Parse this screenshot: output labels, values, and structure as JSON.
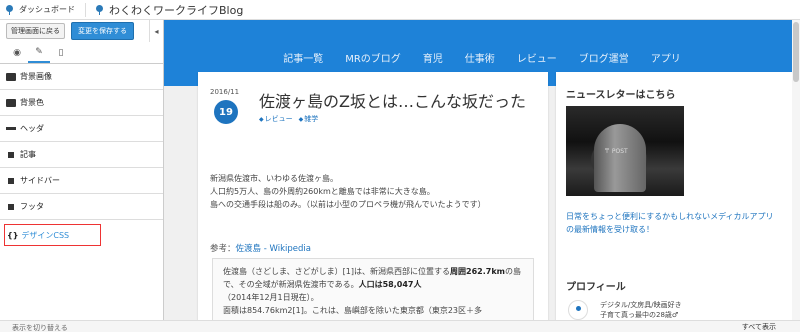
{
  "topbar": {
    "dashboard_label": "ダッシュボード",
    "site_title": "わくわくワークライフBlog"
  },
  "sidebar": {
    "back_label": "管理画面に戻る",
    "save_label": "変更を保存する",
    "collapse_glyph": "◂",
    "tabs": [
      {
        "icon": "palette-icon",
        "glyph": "◉"
      },
      {
        "icon": "wrench-icon",
        "glyph": "✎"
      },
      {
        "icon": "mobile-icon",
        "glyph": "▯"
      }
    ],
    "items": [
      {
        "label": "背景画像"
      },
      {
        "label": "背景色"
      },
      {
        "label": "ヘッダ"
      },
      {
        "label": "記事"
      },
      {
        "label": "サイドバー"
      },
      {
        "label": "フッタ"
      },
      {
        "label": "デザインCSS",
        "prefix": "{}"
      }
    ]
  },
  "preview": {
    "colors": {
      "header": "#1e82d8",
      "accent": "#1e74bf"
    },
    "nav": [
      "記事一覧",
      "MRのブログ",
      "育児",
      "仕事術",
      "レビュー",
      "ブログ運営",
      "アプリ"
    ],
    "post": {
      "year_month": "2016/11",
      "day": "19",
      "title": "佐渡ヶ島のZ坂とは…こんな坂だった",
      "tags": [
        "レビュー",
        "雑学"
      ],
      "paragraphs": [
        "新潟県佐渡市、いわゆる佐渡ヶ島。",
        "人口約5万人、島の外周約260kmと離島では非常に大きな島。",
        "島への交通手段は船のみ。（以前は小型のプロペラ機が飛んでいたようです）"
      ],
      "ref_prefix": "参考：",
      "ref_link": "佐渡島 - Wikipedia",
      "quote_line1": "佐渡島（さどしま、さどがしま）[1]は、新潟県西部に位置する",
      "quote_bold1": "周囲262.7km",
      "quote_line2": "の島で、その全域が新潟県佐渡市である。",
      "quote_bold2": "人口は58,047人",
      "quote_line3": "（2014年12月1日現在）。",
      "quote_line4": "面積は854.76km2[1]。これは、島嶼部を除いた東京都（東京23区＋多"
    },
    "sidebar": {
      "newsletter_title": "ニュースレターはこちら",
      "newsletter_desc": "日常をちょっと便利にするかもしれないメディカルアプリの最新情報を受け取る！",
      "profile_title": "プロフィール",
      "profile_line1": "デジタル/文房具/映画好き",
      "profile_line2": "子育て真っ最中の28歳♂"
    }
  },
  "bottombar": {
    "left_label": "表示を切り替える",
    "right_label": "すべて表示"
  }
}
